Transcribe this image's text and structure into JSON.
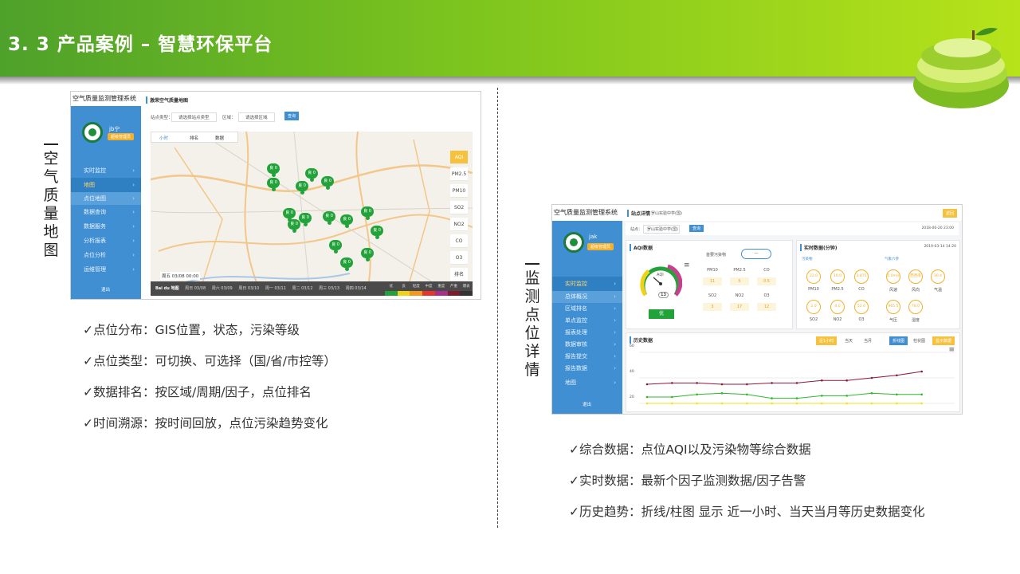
{
  "slide": {
    "title": "3. 3 产品案例 – 智慧环保平台"
  },
  "left": {
    "vertical_label": [
      "空",
      "气",
      "质",
      "量",
      "地",
      "图"
    ],
    "bullets": [
      "✓点位分布：GIS位置，状态，污染等级",
      "✓点位类型：可切换、可选择（国/省/市控等）",
      "✓数据排名：按区域/周期/因子，点位排名",
      "✓时间溯源：按时间回放，点位污染趋势变化"
    ],
    "screenshot": {
      "app_title": "空气质量监测管理系统",
      "page_title": "激荣空气质量地图",
      "user": "jb宁",
      "role": "超级管理员",
      "filter_type_label": "站点类型：",
      "filter_type_value": "请选择站点类型",
      "filter_area_label": "区域：",
      "filter_area_value": "请选择区域",
      "query": "查询",
      "tabs": [
        "小时",
        "排名",
        "数据"
      ],
      "menu": [
        "实时监控",
        "地图",
        "点位地图",
        "数据查询",
        "数据服务",
        "分析报表",
        "点位分析",
        "运维管理"
      ],
      "logout": "退出",
      "factors": [
        "AQI",
        "PM2.5",
        "PM10",
        "SO2",
        "NO2",
        "CO",
        "O3",
        "排名"
      ],
      "pins": [
        "良 0",
        "良 0",
        "良 0",
        "良 0",
        "良 0",
        "良 0",
        "良 0",
        "良 0",
        "良 0",
        "良 0",
        "良 0",
        "良 0",
        "良 0",
        "良 0",
        "良 0"
      ],
      "timeline": [
        "周五 03/08 00:00",
        "周日 03/08",
        "周六 03/09",
        "周日 03/10",
        "周一 03/11",
        "周二 03/12",
        "周三 03/13",
        "周四 03/14"
      ],
      "legend": [
        "优",
        "良",
        "轻度",
        "中度",
        "重度",
        "严重",
        "爆表"
      ],
      "legend_colors": [
        "#22a33a",
        "#f1d21a",
        "#f39a1e",
        "#e8352c",
        "#a72f8e",
        "#7a1f2a",
        "#333333"
      ],
      "baidu": "Bai du 地图"
    }
  },
  "right": {
    "vertical_label": [
      "监",
      "测",
      "点",
      "位",
      "详",
      "情"
    ],
    "bullets": [
      "✓综合数据：点位AQI以及污染物等综合数据",
      "✓实时数据：最新个因子监测数据/因子告警",
      "✓历史趋势：折线/柱图 显示 近一小时、当天当月等历史数据变化"
    ],
    "screenshot": {
      "app_title": "空气质量监测管理系统",
      "page_title": "站点详情",
      "page_sub": "罗山实验中学(国)",
      "back": "返回",
      "site_label": "站点：",
      "site_value": "罗山实验中学(国)",
      "query": "查询",
      "date": "2018-06-20 23:00",
      "user": "jak",
      "role": "超级管理员",
      "menu": [
        "实时监控",
        "总体概况",
        "区域排名",
        "单点监控",
        "报表处理",
        "数据审核",
        "报告提交",
        "报告数据",
        "地图"
      ],
      "logout": "退出",
      "aqi_title": "AQI数据",
      "aqi_value": "13",
      "aqi_level": "优",
      "aqi_label": "AQI",
      "primary_pollutant": "首要污染物",
      "primary_value": "—",
      "pollutants": [
        {
          "name": "PM10",
          "value": "11"
        },
        {
          "name": "PM2.5",
          "value": "5"
        },
        {
          "name": "CO",
          "value": "0.5"
        },
        {
          "name": "SO2",
          "value": "3"
        },
        {
          "name": "NO2",
          "value": "17"
        },
        {
          "name": "O3",
          "value": "12"
        }
      ],
      "realtime_title": "实时数据(分钟)",
      "realtime_time": "2019-03-14 14:20",
      "group_a": "污染物",
      "group_b": "气象六参",
      "circles": [
        {
          "v": "22.0",
          "n": "PM10"
        },
        {
          "v": "19.0",
          "n": "PM2.5"
        },
        {
          "v": "3.875",
          "n": "CO"
        },
        {
          "v": "2.0",
          "n": "SO2"
        },
        {
          "v": "4.0",
          "n": "NO2"
        },
        {
          "v": "52.0",
          "n": "O3"
        }
      ],
      "weather": [
        {
          "v": "0.0m/s",
          "n": "风速"
        },
        {
          "v": "西西南",
          "n": "风向"
        },
        {
          "v": "30.4",
          "n": "气温"
        },
        {
          "v": "965.5",
          "n": "气压"
        },
        {
          "v": "78.0",
          "n": "湿度"
        }
      ],
      "history_title": "历史数据",
      "history_tabs": [
        "近1小时",
        "当天",
        "当月"
      ],
      "chart_tabs": [
        "折线图",
        "柱状图",
        "显示数据"
      ],
      "y_ticks": [
        "60",
        "40",
        "20"
      ]
    }
  },
  "chart_data": {
    "type": "line",
    "title": "历史数据",
    "ylim": [
      15,
      65
    ],
    "x": [
      1,
      2,
      3,
      4,
      5,
      6,
      7,
      8,
      9,
      10,
      11,
      12,
      13
    ],
    "series": [
      {
        "color": "#8a1b3a",
        "values": [
          35,
          36,
          36,
          35,
          35,
          36,
          36,
          38,
          38,
          40,
          42,
          45,
          0
        ]
      },
      {
        "color": "#2db82d",
        "values": [
          25,
          25,
          27,
          28,
          27,
          24,
          24,
          26,
          26,
          28,
          27,
          27,
          0
        ]
      },
      {
        "color": "#f1e01a",
        "values": [
          20,
          20,
          20,
          20,
          20,
          20,
          20,
          20,
          20,
          20,
          20,
          20,
          0
        ]
      }
    ]
  }
}
